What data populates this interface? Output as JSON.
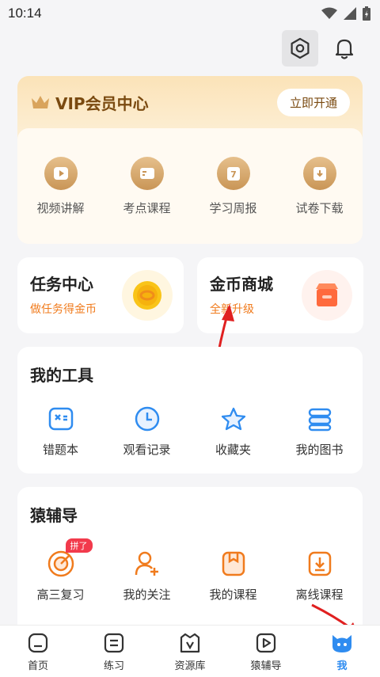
{
  "status_bar": {
    "time": "10:14"
  },
  "vip": {
    "title": "VIP会员中心",
    "open_button": "立即开通",
    "items": [
      {
        "label": "视频讲解",
        "icon": "play-icon"
      },
      {
        "label": "考点课程",
        "icon": "card-icon"
      },
      {
        "label": "学习周报",
        "icon": "calendar-7-icon"
      },
      {
        "label": "试卷下载",
        "icon": "download-icon"
      }
    ]
  },
  "task_center": {
    "title": "任务中心",
    "subtitle": "做任务得金币"
  },
  "coin_mall": {
    "title": "金币商城",
    "subtitle": "全新升级"
  },
  "tools": {
    "title": "我的工具",
    "items": [
      {
        "label": "错题本",
        "icon": "mistake-book-icon"
      },
      {
        "label": "观看记录",
        "icon": "clock-icon"
      },
      {
        "label": "收藏夹",
        "icon": "star-icon"
      },
      {
        "label": "我的图书",
        "icon": "books-icon"
      }
    ]
  },
  "fudao": {
    "title": "猿辅导",
    "badge": "拼了",
    "items": [
      {
        "label": "高三复习",
        "icon": "target-icon"
      },
      {
        "label": "我的关注",
        "icon": "follow-icon"
      },
      {
        "label": "我的课程",
        "icon": "course-icon"
      },
      {
        "label": "离线课程",
        "icon": "offline-icon"
      }
    ]
  },
  "tab_bar": {
    "tabs": [
      {
        "label": "首页",
        "icon": "home-icon"
      },
      {
        "label": "练习",
        "icon": "practice-icon"
      },
      {
        "label": "资源库",
        "icon": "library-icon"
      },
      {
        "label": "猿辅导",
        "icon": "video-icon"
      },
      {
        "label": "我",
        "icon": "me-icon",
        "active": true
      }
    ]
  },
  "colors": {
    "accent_orange": "#f07b1d",
    "active_blue": "#2f8cf0",
    "vip_brown": "#7a4a10"
  }
}
